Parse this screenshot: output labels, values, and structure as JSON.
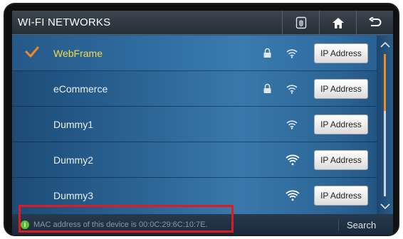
{
  "header": {
    "title": "WI-FI NETWORKS",
    "buttons": [
      {
        "name": "touch-icon"
      },
      {
        "name": "home-icon"
      },
      {
        "name": "back-icon"
      }
    ]
  },
  "networks": [
    {
      "name": "WebFrame",
      "selected": true,
      "locked": true,
      "signal": 3,
      "button_label": "IP Address"
    },
    {
      "name": "eCommerce",
      "selected": false,
      "locked": true,
      "signal": 3,
      "button_label": "IP Address"
    },
    {
      "name": "Dummy1",
      "selected": false,
      "locked": false,
      "signal": 3,
      "button_label": "IP Address"
    },
    {
      "name": "Dummy2",
      "selected": false,
      "locked": false,
      "signal": 4,
      "button_label": "IP Address"
    },
    {
      "name": "Dummy3",
      "selected": false,
      "locked": false,
      "signal": 4,
      "button_label": "IP Address"
    }
  ],
  "footer": {
    "info_glyph": "i",
    "status_text": "MAC address of this device is 00:0C:29:6C:10:7E.",
    "search_label": "Search"
  },
  "colors": {
    "selected_text": "#f5d94a",
    "check": "#f08a1c",
    "scroll_thumb": "#f08a1c",
    "highlight_box": "#e11a22",
    "info_icon": "#5cbf3c"
  }
}
